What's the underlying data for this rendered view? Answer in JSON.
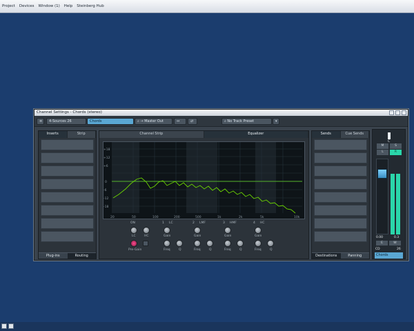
{
  "menubar": {
    "items": [
      "Project",
      "Devices",
      "Window (1)",
      "Help",
      "Steinberg Hub"
    ]
  },
  "window": {
    "title": "Channel Settings - Chords (stereo)"
  },
  "toolbar": {
    "sources": "4-Sources",
    "channel_number": "26",
    "channel_name": "Chords",
    "output": "Master Out",
    "preset": "No Track Preset"
  },
  "inserts": {
    "tabs": [
      "Inserts",
      "Strip"
    ],
    "bottom_tabs": [
      "Plug-ins",
      "Routing"
    ]
  },
  "center": {
    "tabs": [
      "Channel Strip",
      "Equalizer"
    ]
  },
  "eq": {
    "freq_labels": [
      "20",
      "50",
      "100",
      "200",
      "500",
      "1k",
      "2k",
      "5k",
      "10k"
    ],
    "db_labels": [
      "+24",
      "+18",
      "+12",
      "+6",
      "0",
      "-6",
      "-12",
      "-18",
      "-24"
    ],
    "bands": [
      {
        "num": "1",
        "name": "LC"
      },
      {
        "num": "2",
        "name": "LMF"
      },
      {
        "num": "3",
        "name": "HMF"
      },
      {
        "num": "4",
        "name": "HC"
      }
    ],
    "knob_labels": {
      "gain": "Gain",
      "freq": "Freq",
      "q": "Q",
      "lc": "LC",
      "hc": "HC"
    },
    "fx_label": "Pre-Gain",
    "eq_on_label": "ON"
  },
  "sends": {
    "tabs": [
      "Sends",
      "Cue Sends"
    ],
    "bottom_tabs": [
      "Destinations",
      "Panning"
    ]
  },
  "fader": {
    "buttons": [
      "M",
      "S",
      "L",
      "R",
      "E",
      "W"
    ],
    "vol_readout": "0.00",
    "peak_readout": "0.3",
    "chan_label": "CD",
    "chan_num": "26",
    "name": "Chords",
    "pan_label": "C"
  },
  "colors": {
    "accent": "#5aa7d3",
    "curve": "#6bd400",
    "meter": "#2ad6aa",
    "window_bg": "#3a434d",
    "desktop": "#1b3d6e"
  }
}
